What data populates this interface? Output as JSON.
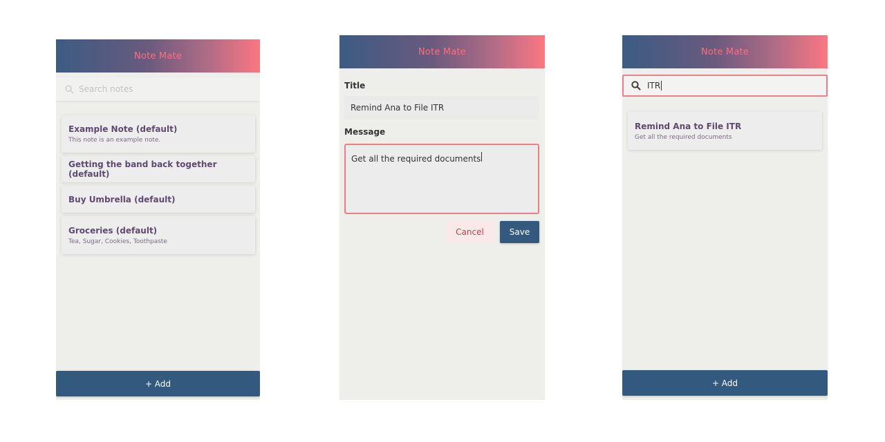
{
  "app": {
    "title": "Note Mate"
  },
  "list_screen": {
    "search_placeholder": "Search notes",
    "notes": [
      {
        "title": "Example Note (default)",
        "subtitle": "This note is an example note."
      },
      {
        "title": "Getting the band back together (default)",
        "subtitle": ""
      },
      {
        "title": "Buy Umbrella (default)",
        "subtitle": ""
      },
      {
        "title": "Groceries (default)",
        "subtitle": "Tea, Sugar, Cookies, Toothpaste"
      }
    ],
    "add_label": "+ Add"
  },
  "edit_screen": {
    "title_label": "Title",
    "title_value": "Remind Ana to File ITR",
    "message_label": "Message",
    "message_value": "Get all the required documents",
    "cancel_label": "Cancel",
    "save_label": "Save"
  },
  "search_screen": {
    "query": "ITR",
    "results": [
      {
        "title": "Remind Ana to File ITR",
        "subtitle": "Get all the required documents"
      }
    ],
    "add_label": "+ Add"
  },
  "colors": {
    "primary": "#335a7e",
    "accent": "#fb7782",
    "note_title": "#5e4a6e"
  }
}
